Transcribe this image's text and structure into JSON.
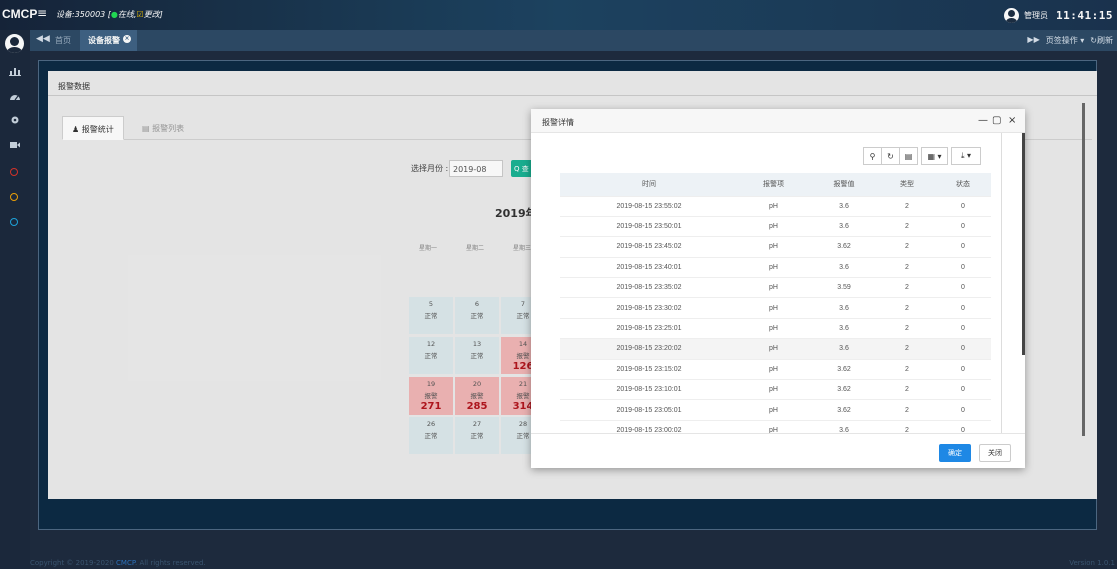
{
  "header": {
    "brand": "CMCP",
    "device_prefix": "设备:",
    "device_id": "350003",
    "bracket_open": "[",
    "status_online": "在线,",
    "status_change": "更改",
    "bracket_close": "]",
    "user": "管理员",
    "time": "11:41:15"
  },
  "tabs": {
    "home": "首页",
    "active": "设备报警",
    "tab_ops": "页签操作",
    "refresh": "刷新"
  },
  "panel": {
    "title": "报警数据",
    "tabs": [
      "报警统计",
      "报警列表"
    ],
    "month_label": "选择月份 :",
    "month_value": "2019-08",
    "query_label": "Q 查",
    "calendar_title": "2019年",
    "weekdays": [
      "星期一",
      "星期二",
      "星期三"
    ],
    "calendar_cells": [
      {
        "day": "5",
        "status": "正常",
        "count": ""
      },
      {
        "day": "6",
        "status": "正常",
        "count": ""
      },
      {
        "day": "7",
        "status": "正常",
        "count": ""
      },
      {
        "day": "12",
        "status": "正常",
        "count": ""
      },
      {
        "day": "13",
        "status": "正常",
        "count": ""
      },
      {
        "day": "14",
        "status": "报警",
        "count": "126"
      },
      {
        "day": "19",
        "status": "报警",
        "count": "271"
      },
      {
        "day": "20",
        "status": "报警",
        "count": "285"
      },
      {
        "day": "21",
        "status": "报警",
        "count": "314"
      },
      {
        "day": "26",
        "status": "正常",
        "count": ""
      },
      {
        "day": "27",
        "status": "正常",
        "count": ""
      },
      {
        "day": "28",
        "status": "正常",
        "count": ""
      }
    ]
  },
  "modal": {
    "title": "报警详情",
    "columns": [
      "时间",
      "报警项",
      "报警值",
      "类型",
      "状态"
    ],
    "rows": [
      [
        "2019-08-15 23:55:02",
        "pH",
        "3.6",
        "2",
        "0"
      ],
      [
        "2019-08-15 23:50:01",
        "pH",
        "3.6",
        "2",
        "0"
      ],
      [
        "2019-08-15 23:45:02",
        "pH",
        "3.62",
        "2",
        "0"
      ],
      [
        "2019-08-15 23:40:01",
        "pH",
        "3.6",
        "2",
        "0"
      ],
      [
        "2019-08-15 23:35:02",
        "pH",
        "3.59",
        "2",
        "0"
      ],
      [
        "2019-08-15 23:30:02",
        "pH",
        "3.6",
        "2",
        "0"
      ],
      [
        "2019-08-15 23:25:01",
        "pH",
        "3.6",
        "2",
        "0"
      ],
      [
        "2019-08-15 23:20:02",
        "pH",
        "3.6",
        "2",
        "0"
      ],
      [
        "2019-08-15 23:15:02",
        "pH",
        "3.62",
        "2",
        "0"
      ],
      [
        "2019-08-15 23:10:01",
        "pH",
        "3.62",
        "2",
        "0"
      ],
      [
        "2019-08-15 23:05:01",
        "pH",
        "3.62",
        "2",
        "0"
      ],
      [
        "2019-08-15 23:00:02",
        "pH",
        "3.6",
        "2",
        "0"
      ]
    ],
    "highlight_row": 7,
    "ok_label": "确定",
    "close_label": "关闭"
  },
  "footer": {
    "copyright_prefix": "Copyright © 2019-2020 ",
    "copyright_link": "CMCP",
    "copyright_suffix": ". All rights reserved.",
    "version": "Version 1.0.1"
  },
  "colors": {
    "accent_green": "#1ab394",
    "accent_blue": "#1e88e5",
    "alarm_bg": "#f1b6b6",
    "alarm_text": "#b3161e",
    "ring_red": "#d9342b",
    "ring_orange": "#f0a30a",
    "ring_cyan": "#1fa8e0"
  },
  "icons": {
    "sidebar": [
      "chart-icon",
      "dashboard-icon",
      "gear-icon",
      "camera-icon",
      "ring-red-icon",
      "ring-orange-icon",
      "ring-cyan-icon"
    ],
    "toolbar": [
      "search-icon",
      "refresh-icon",
      "toggle-view-icon",
      "columns-icon",
      "export-icon"
    ]
  }
}
